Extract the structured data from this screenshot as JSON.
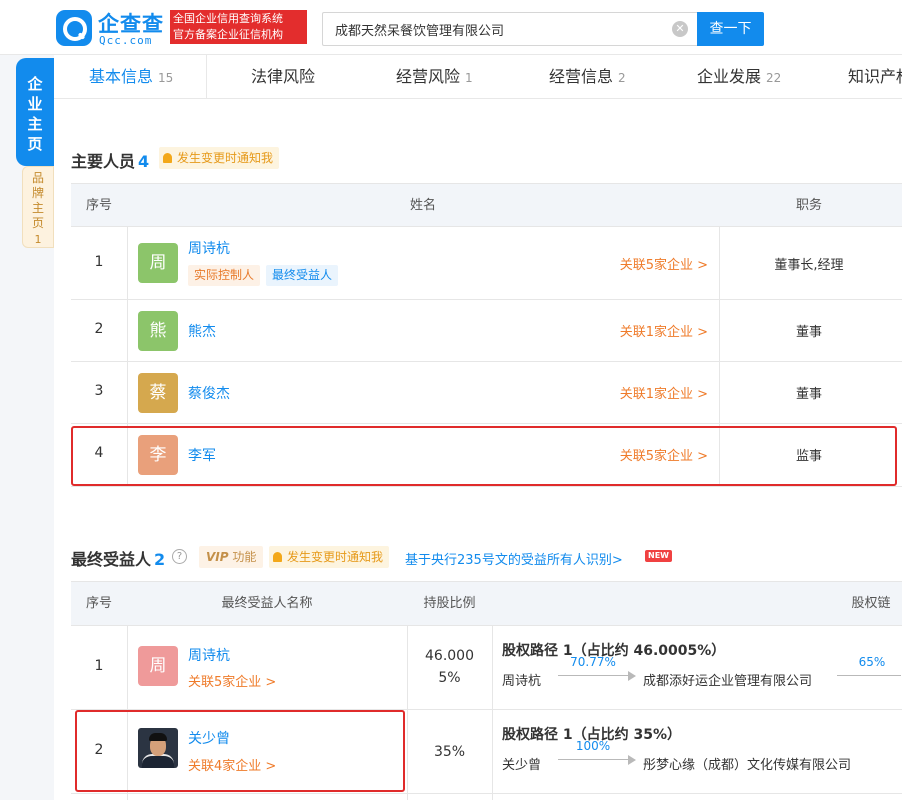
{
  "header": {
    "logo_name": "企查查",
    "logo_domain": "Qcc.com",
    "badge_line1": "全国企业信用查询系统",
    "badge_line2": "官方备案企业征信机构",
    "search_value": "成都天然呆餐饮管理有限公司",
    "clear_symbol": "✕",
    "search_button": "查一下"
  },
  "side_tabs": {
    "main": "企业主页",
    "brand": "品牌主页",
    "brand_count": "1"
  },
  "tabs": [
    {
      "label": "基本信息",
      "count": "15",
      "active": true
    },
    {
      "label": "法律风险",
      "count": ""
    },
    {
      "label": "经营风险",
      "count": "1"
    },
    {
      "label": "经营信息",
      "count": "2"
    },
    {
      "label": "企业发展",
      "count": "22"
    },
    {
      "label": "知识产权",
      "count": ""
    }
  ],
  "personnel": {
    "title": "主要人员",
    "count": "4",
    "notify": "发生变更时通知我",
    "headers": {
      "index": "序号",
      "name": "姓名",
      "role": "职务"
    },
    "rows": [
      {
        "index": "1",
        "avatar": "周",
        "avatar_color": "#8cc56a",
        "name": "周诗杭",
        "tags": [
          "实际控制人",
          "最终受益人"
        ],
        "related": "关联5家企业 >",
        "role": "董事长,经理"
      },
      {
        "index": "2",
        "avatar": "熊",
        "avatar_color": "#8cc56a",
        "name": "熊杰",
        "tags": [],
        "related": "关联1家企业 >",
        "role": "董事"
      },
      {
        "index": "3",
        "avatar": "蔡",
        "avatar_color": "#d5a84e",
        "name": "蔡俊杰",
        "tags": [],
        "related": "关联1家企业 >",
        "role": "董事"
      },
      {
        "index": "4",
        "avatar": "李",
        "avatar_color": "#e9a07b",
        "name": "李军",
        "tags": [],
        "related": "关联5家企业 >",
        "role": "监事"
      }
    ]
  },
  "beneficiaries": {
    "title": "最终受益人",
    "count": "2",
    "help_symbol": "?",
    "vip_label": "VIP",
    "vip_suffix": "功能",
    "notify": "发生变更时通知我",
    "link": "基于央行235号文的受益所有人识别>",
    "new_badge": "NEW",
    "headers": {
      "index": "序号",
      "name": "最终受益人名称",
      "ratio": "持股比例",
      "chain": "股权链"
    },
    "rows": [
      {
        "index": "1",
        "avatar": "周",
        "avatar_color": "#ef9a9a",
        "name": "周诗杭",
        "related": "关联5家企业 >",
        "ratio_line1": "46.000",
        "ratio_line2": "5%",
        "path_title": "股权路径 1（占比约 46.0005%）",
        "path_start": "周诗杭",
        "pct1": "70.77%",
        "path_company": "成都添好运企业管理有限公司",
        "pct2": "65%"
      },
      {
        "index": "2",
        "name": "关少曾",
        "related": "关联4家企业 >",
        "ratio_line1": "35%",
        "path_title": "股权路径 1（占比约 35%）",
        "path_start": "关少曾",
        "pct1": "100%",
        "path_company": "彤梦心缘（成都）文化传媒有限公司"
      }
    ]
  },
  "colors": {
    "accent": "#128bed",
    "orange": "#ef7b2a",
    "highlight": "#e02b2b"
  }
}
